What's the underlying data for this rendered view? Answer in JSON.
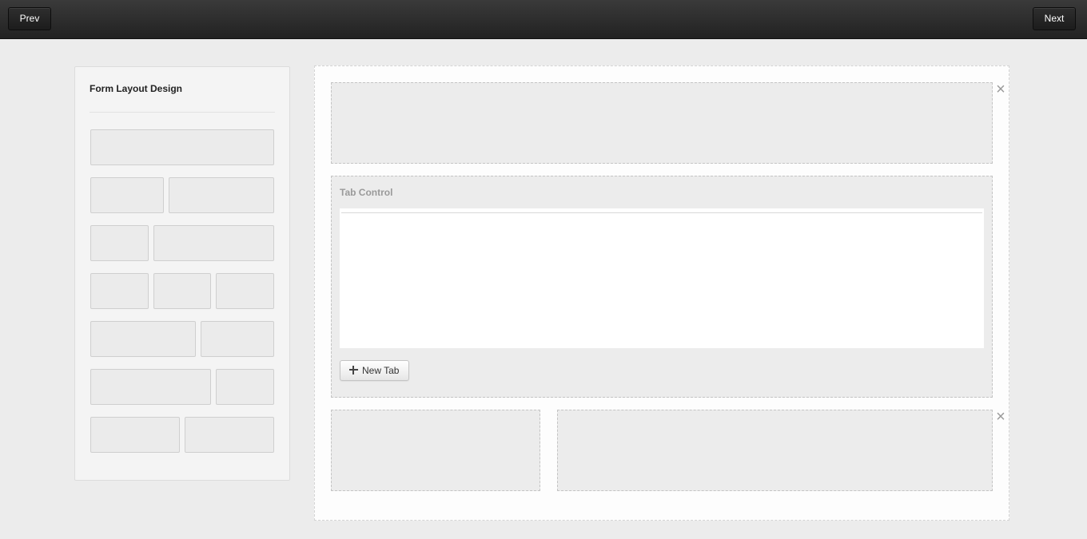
{
  "topbar": {
    "prev_label": "Prev",
    "next_label": "Next"
  },
  "palette": {
    "title": "Form Layout Design",
    "templates": [
      {
        "name": "one-column",
        "columns": 1
      },
      {
        "name": "two-columns-narrow-wide",
        "columns": 2
      },
      {
        "name": "two-columns-small-large",
        "columns": 2
      },
      {
        "name": "three-columns-equal",
        "columns": 3
      },
      {
        "name": "two-columns-wide-narrow",
        "columns": 2
      },
      {
        "name": "two-columns-large-small",
        "columns": 2
      },
      {
        "name": "two-columns-equal",
        "columns": 2
      }
    ]
  },
  "canvas": {
    "tab_control": {
      "title": "Tab Control",
      "new_tab_label": "New Tab"
    },
    "icons": {
      "close": "close-icon",
      "add": "plus-icon"
    }
  }
}
